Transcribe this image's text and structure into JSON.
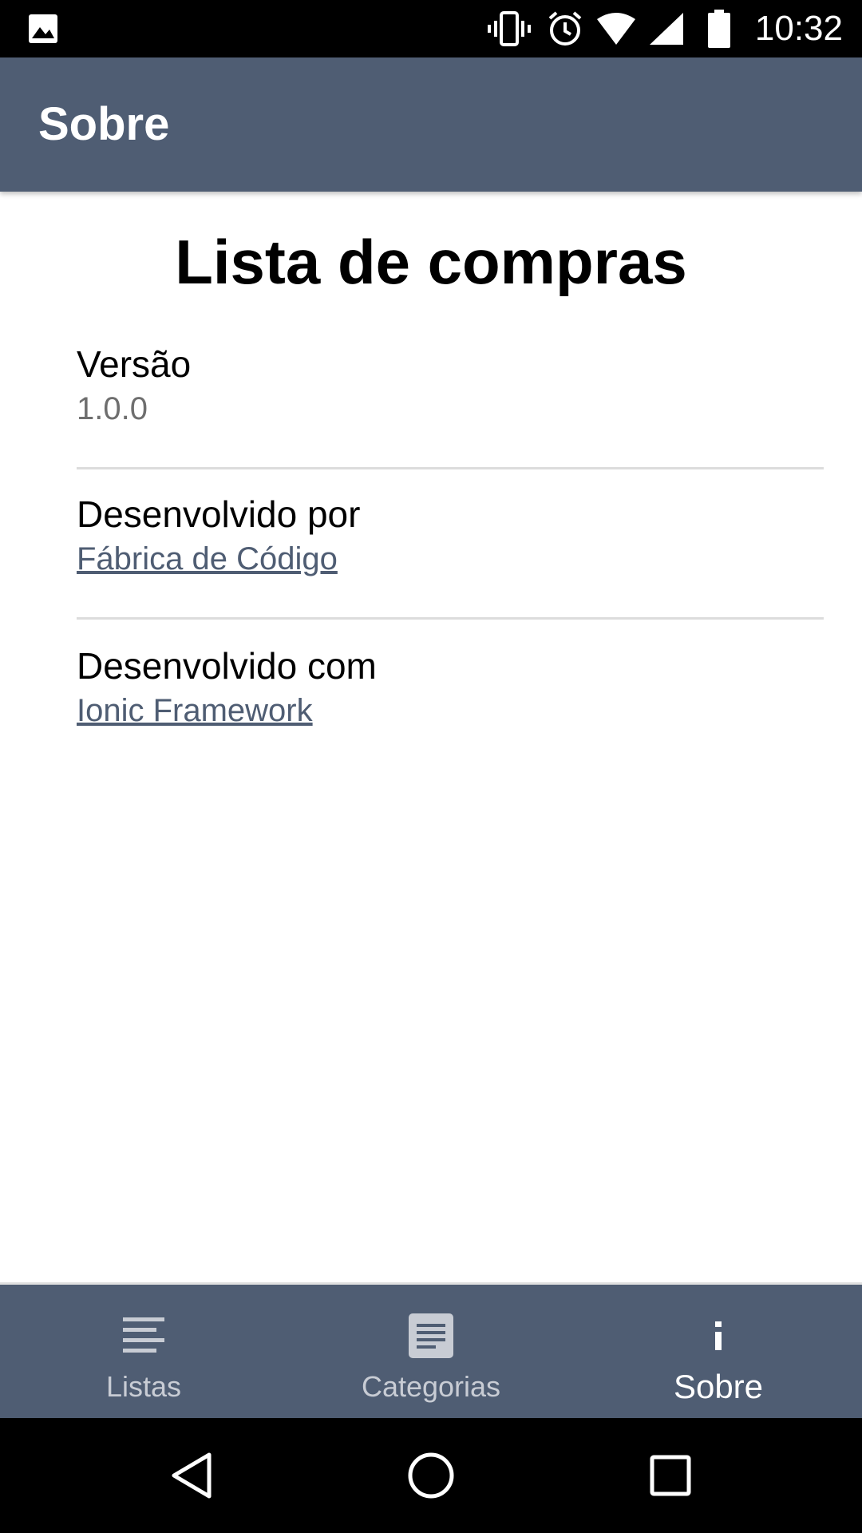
{
  "status_bar": {
    "time": "10:32",
    "icons": [
      "image-icon",
      "vibrate-icon",
      "alarm-icon",
      "wifi-icon",
      "signal-icon",
      "battery-icon"
    ]
  },
  "header": {
    "title": "Sobre"
  },
  "main": {
    "app_title": "Lista de compras",
    "items": [
      {
        "label": "Versão",
        "value": "1.0.0"
      },
      {
        "label": "Desenvolvido por",
        "link": "Fábrica de Código"
      },
      {
        "label": "Desenvolvido com",
        "link": "Ionic Framework"
      }
    ]
  },
  "tabs": [
    {
      "label": "Listas",
      "icon": "list-icon",
      "active": false
    },
    {
      "label": "Categorias",
      "icon": "document-icon",
      "active": false
    },
    {
      "label": "Sobre",
      "icon": "info-icon",
      "active": true
    }
  ],
  "nav_bar": {
    "buttons": [
      "back-icon",
      "home-icon",
      "recents-icon"
    ]
  },
  "colors": {
    "primary": "#4f5d73",
    "status_bar": "#000000",
    "link": "#4f5d73",
    "secondary_text": "#6e6e6e",
    "divider": "#dcdcdc",
    "inactive_tab": "#c8ccd4"
  }
}
